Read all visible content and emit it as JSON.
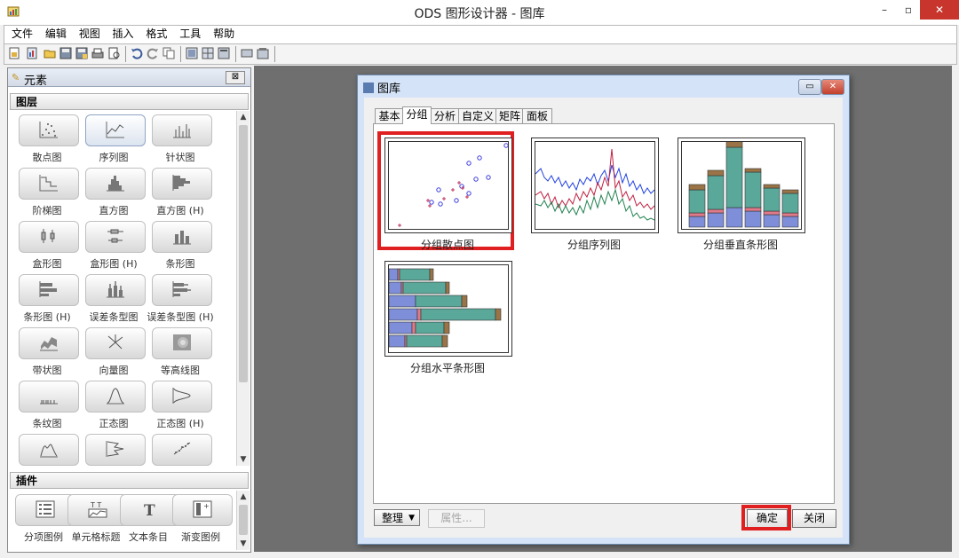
{
  "window": {
    "title": "ODS 图形设计器 - 图库"
  },
  "menubar": [
    "文件",
    "编辑",
    "视图",
    "插入",
    "格式",
    "工具",
    "帮助"
  ],
  "left_panel": {
    "title": "元素",
    "layers_section": "图层",
    "layers": [
      {
        "label": "散点图",
        "icon": "scatter-icon"
      },
      {
        "label": "序列图",
        "icon": "series-icon"
      },
      {
        "label": "针状图",
        "icon": "needle-icon"
      },
      {
        "label": "阶梯图",
        "icon": "step-icon"
      },
      {
        "label": "直方图",
        "icon": "histogram-icon"
      },
      {
        "label": "直方图 (H)",
        "icon": "histogram-h-icon"
      },
      {
        "label": "盒形图",
        "icon": "box-icon"
      },
      {
        "label": "盒形图 (H)",
        "icon": "box-h-icon"
      },
      {
        "label": "条形图",
        "icon": "bar-icon"
      },
      {
        "label": "条形图 (H)",
        "icon": "bar-h-icon"
      },
      {
        "label": "误差条型图",
        "icon": "errorbar-icon"
      },
      {
        "label": "误差条型图 (H)",
        "icon": "errorbar-h-icon"
      },
      {
        "label": "带状图",
        "icon": "band-icon"
      },
      {
        "label": "向量图",
        "icon": "vector-icon"
      },
      {
        "label": "等高线图",
        "icon": "contour-icon"
      },
      {
        "label": "条纹图",
        "icon": "fringe-icon"
      },
      {
        "label": "正态图",
        "icon": "normal-icon"
      },
      {
        "label": "正态图 (H)",
        "icon": "normal-h-icon"
      },
      {
        "label": "",
        "icon": "density-icon"
      },
      {
        "label": "",
        "icon": "density-h-icon"
      },
      {
        "label": "",
        "icon": "loess-icon"
      }
    ],
    "plugins_section": "插件",
    "plugins": [
      {
        "label": "分项图例",
        "icon": "legend-icon"
      },
      {
        "label": "单元格标题",
        "icon": "cell-header-icon"
      },
      {
        "label": "文本条目",
        "icon": "text-entry-icon"
      },
      {
        "label": "渐变图例",
        "icon": "gradient-legend-icon"
      }
    ]
  },
  "dialog": {
    "title": "图库",
    "tabs": [
      "基本",
      "分组",
      "分析",
      "自定义",
      "矩阵",
      "面板"
    ],
    "active_tab": "分组",
    "gallery": [
      "分组散点图",
      "分组序列图",
      "分组垂直条形图",
      "分组水平条形图"
    ],
    "selected": "分组散点图",
    "organize_label": "整理",
    "properties_label": "属性...",
    "ok_label": "确定",
    "close_label": "关闭"
  },
  "colors": {
    "highlight": "#e02020",
    "bar_teal": "#5aa89a",
    "bar_blue": "#7e8ed8",
    "bar_brown": "#9a7447",
    "bar_pink": "#e07a8a"
  }
}
